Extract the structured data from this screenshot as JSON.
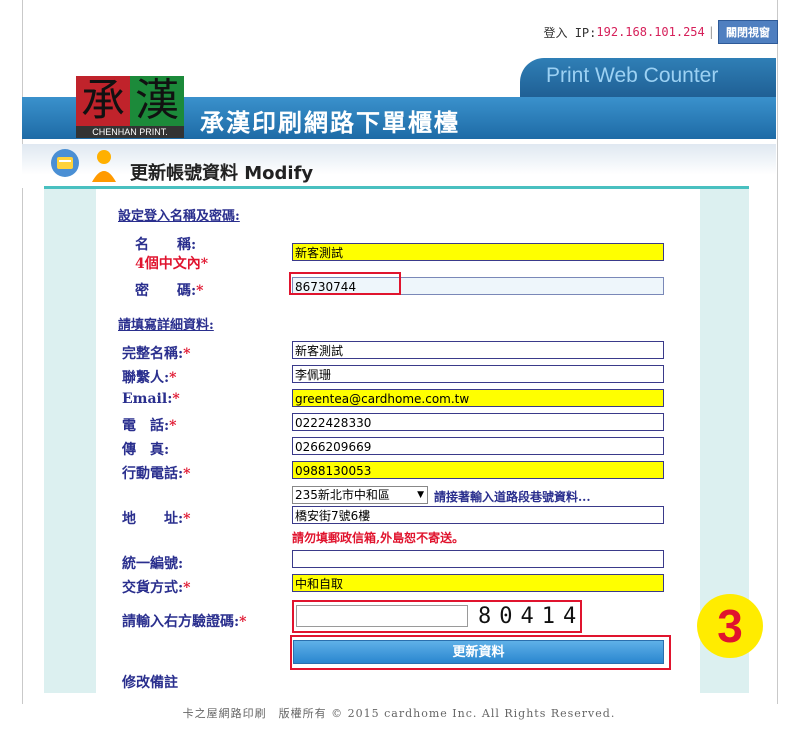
{
  "topbar": {
    "login_label": "登入 IP:",
    "ip": "192.168.101.254",
    "separator": "|",
    "close_button": "關閉視窗"
  },
  "brand": {
    "char1": "承",
    "char2": "漢",
    "logo_sub": "CHENHAN PRINT.",
    "site_title": "承漢印刷網路下單櫃檯",
    "counter_name": "Print Web Counter"
  },
  "page": {
    "title": "更新帳號資料 Modify"
  },
  "login_section": {
    "heading": "設定登入名稱及密碼:",
    "name_label": "名　　稱:",
    "name_hint": "4個中文內",
    "name_value": "新客測試",
    "password_label": "密　　碼:",
    "password_value": "86730744",
    "required_mark": "*"
  },
  "detail_section": {
    "heading": "請填寫詳細資料:",
    "fullname_label": "完整名稱:",
    "fullname_value": "新客測試",
    "contact_label": "聯繫人:",
    "contact_value": "李佩珊",
    "email_label": "Email:",
    "email_value": "greentea@cardhome.com.tw",
    "phone_label": "電　話:",
    "phone_value": "0222428330",
    "fax_label": "傳　真:",
    "fax_value": "0266209669",
    "mobile_label": "行動電話:",
    "mobile_value": "0988130053",
    "address_label": "地　　址:",
    "address_district": "235新北市中和區",
    "address_prompt": "請接著輸入道路段巷號資料...",
    "address_value": "橋安街7號6樓",
    "address_warning": "請勿填郵政信箱,外島恕不寄送。",
    "taxid_label": "統一編號:",
    "taxid_value": "",
    "delivery_label": "交貨方式:",
    "delivery_value": "中和自取",
    "captcha_label": "請輸入右方驗證碼:",
    "captcha_value": "",
    "captcha_code": "80414",
    "submit_label": "更新資料",
    "notes_label": "修改備註"
  },
  "annotation": {
    "step_number": "3"
  },
  "footer": {
    "text": "卡之屋網路印刷　版權所有 © 2015 cardhome Inc. All Rights Reserved."
  },
  "colors": {
    "accent_blue": "#2a86cf",
    "highlight_yellow": "#ffff00",
    "required_red": "#e0142e",
    "label_navy": "#2a2f8e"
  }
}
